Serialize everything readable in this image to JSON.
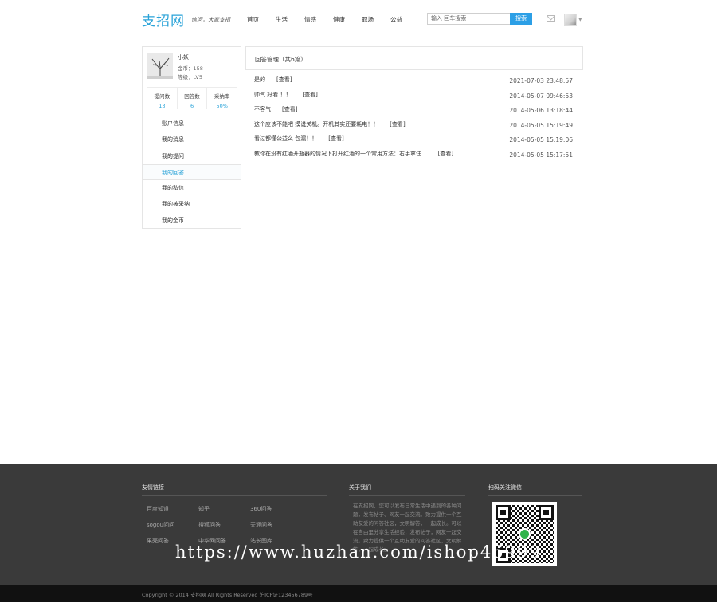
{
  "header": {
    "logo": "支招网",
    "slogan": "信问，大家支招",
    "nav": [
      "首页",
      "生活",
      "情感",
      "健康",
      "职场",
      "公益"
    ],
    "search": {
      "placeholder": "输入 回车搜索",
      "button": "搜索"
    }
  },
  "sidebar": {
    "name": "小妖",
    "coins": "金币：158",
    "level": "等级：LV5",
    "stats": [
      {
        "label": "提问数",
        "value": "13"
      },
      {
        "label": "回答数",
        "value": "6"
      },
      {
        "label": "采纳率",
        "value": "50%"
      }
    ],
    "menu": [
      "账户信息",
      "我的消息",
      "我的提问",
      "我的回答",
      "我的私信",
      "我的被采纳",
      "我的金币"
    ],
    "active_index": 3
  },
  "main": {
    "title": "回答管理（共6篇）",
    "view_label": "[查看]",
    "answers": [
      {
        "text": "是的",
        "time": "2021-07-03 23:48:57"
      },
      {
        "text": "帅气 好看 ！！",
        "time": "2014-05-07 09:46:53"
      },
      {
        "text": "不客气",
        "time": "2014-05-06 13:18:44"
      },
      {
        "text": "这个应该不能吧 摸说关机。开机其实还要耗电！！",
        "time": "2014-05-05 15:19:49"
      },
      {
        "text": "看过都懂公益么 包漏！！",
        "time": "2014-05-05 15:19:06"
      },
      {
        "text": "教你在没有红酒开瓶器的情况下打开红酒的一个常用方法：右手拿住...",
        "time": "2014-05-05 15:17:51"
      }
    ]
  },
  "footer": {
    "links_title": "友情链接",
    "links": [
      "百度知道",
      "知乎",
      "360问答",
      "sogou问问",
      "搜狐问答",
      "天涯问答",
      "果壳问答",
      "中华网问答",
      "站长图库"
    ],
    "about_title": "关于我们",
    "about_text": "在支招网，您可以发布日常生活中遇到的各种问题，发布帖子、网友一起交流。致力提供一个互助友爱的问答社区，文明解答，一起成长。可以在自由里分享生活经验，发布帖子，网友一起交流。致力提供一个互助友爱的问答社区，文明解答，一起成长。",
    "qr_title": "扫码关注微信",
    "watermark": "https://www.huzhan.com/ishop46999",
    "copyright": "Copyright © 2014 支招网 All Rights Reserved 沪ICP证123456789号"
  }
}
